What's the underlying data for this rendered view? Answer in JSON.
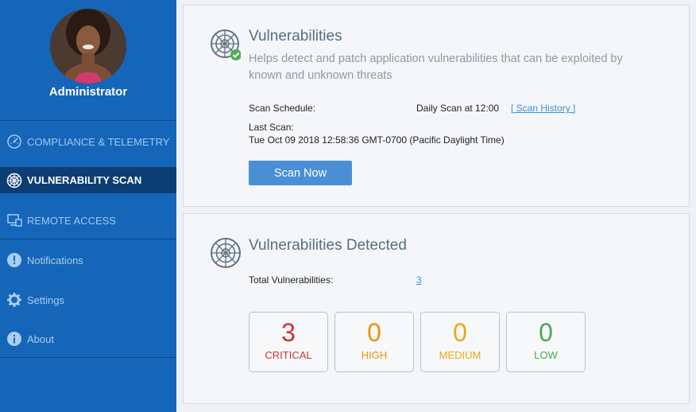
{
  "sidebar": {
    "user_name": "Administrator",
    "items": [
      {
        "label": "COMPLIANCE & TELEMETRY",
        "icon": "gauge-icon"
      },
      {
        "label": "VULNERABILITY SCAN",
        "icon": "radar-icon",
        "active": true
      },
      {
        "label": "REMOTE ACCESS",
        "icon": "remote-desktop-icon"
      },
      {
        "label": "Notifications",
        "icon": "exclamation-icon"
      },
      {
        "label": "Settings",
        "icon": "gear-icon"
      },
      {
        "label": "About",
        "icon": "info-icon"
      }
    ]
  },
  "scan_card": {
    "title": "Vulnerabilities",
    "description_line1": "Helps detect and patch application vulnerabilities that can be exploited by",
    "description_line2": "known and unknown threats",
    "schedule_label": "Scan Schedule:",
    "schedule_value": "Daily Scan at 12:00",
    "history_link": "[ Scan History ]",
    "last_scan_label": "Last Scan:",
    "last_scan_value": "Tue Oct 09 2018 12:58:36 GMT-0700 (Pacific Daylight Time)",
    "button_label": "Scan Now"
  },
  "detected_card": {
    "title": "Vulnerabilities Detected",
    "total_label": "Total Vulnerabilities:",
    "total_value": "3",
    "severities": [
      {
        "count": "3",
        "label": "CRITICAL",
        "color": "#cc3333"
      },
      {
        "count": "0",
        "label": "HIGH",
        "color": "#f0900c"
      },
      {
        "count": "0",
        "label": "MEDIUM",
        "color": "#f0a516"
      },
      {
        "count": "0",
        "label": "LOW",
        "color": "#4aa851"
      }
    ]
  },
  "colors": {
    "sidebar": "#1565b8",
    "sidebar_active": "#0c3e74",
    "accent": "#4a8fd6",
    "check": "#4caf50"
  }
}
